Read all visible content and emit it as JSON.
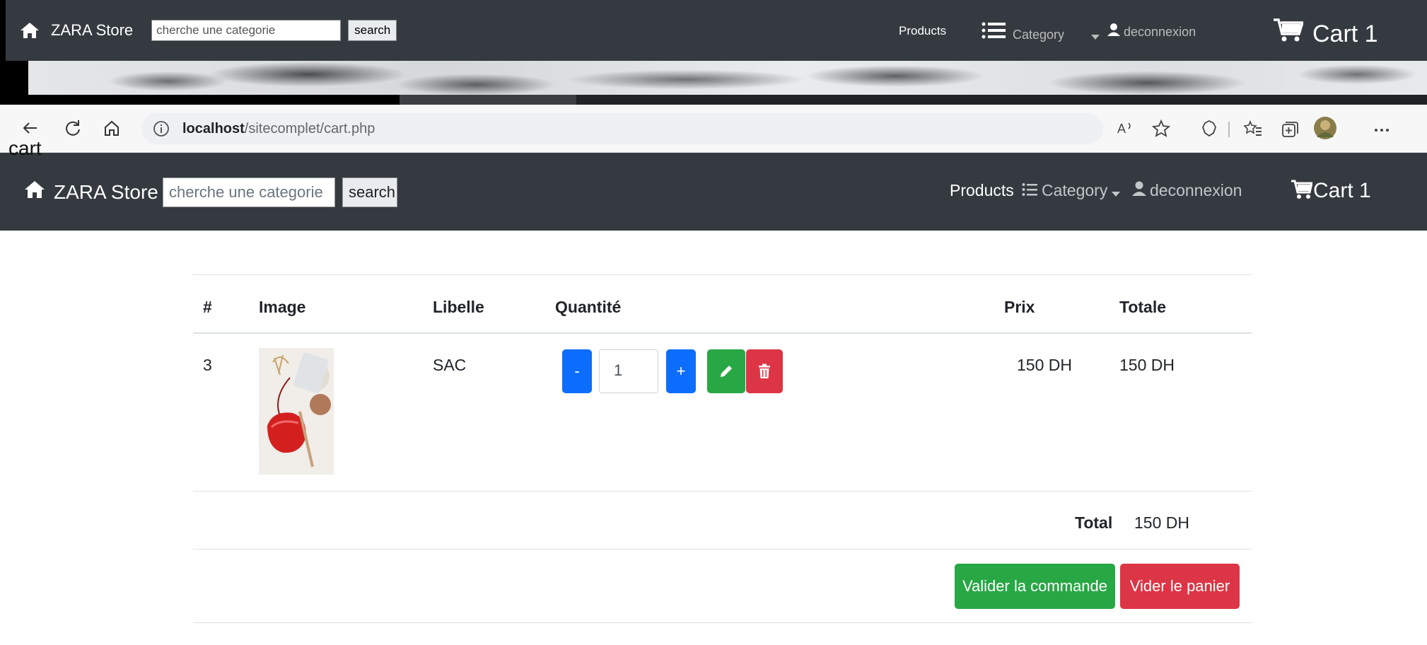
{
  "outer_nav": {
    "brand": "ZARA Store",
    "search_placeholder": "cherche une categorie",
    "search_label": "search",
    "products": "Products",
    "category": "Category",
    "logout": "deconnexion",
    "cart": "Cart 1"
  },
  "browser": {
    "url_host": "localhost",
    "url_path": "/sitecomplet/cart.php",
    "read_aloud": "A"
  },
  "inner_nav": {
    "brand": "ZARA Store",
    "search_placeholder": "cherche une categorie",
    "search_label": "search",
    "products": "Products",
    "category": "Category",
    "logout": "deconnexion",
    "cart": "Cart 1"
  },
  "page": {
    "title": "cart",
    "columns": [
      "#",
      "Image",
      "Libelle",
      "Quantité",
      "Prix",
      "Totale"
    ],
    "rows": [
      {
        "id": "3",
        "libelle": "SAC",
        "quantity": "1",
        "price": "150 DH",
        "total": "150 DH"
      }
    ],
    "minus_label": "-",
    "plus_label": "+",
    "grand_total_label": "Total",
    "grand_total_value": "150 DH",
    "validate_button": "Valider la commande",
    "empty_button": "Vider le panier"
  },
  "colors": {
    "navbar": "#343a40",
    "primary": "#0d6efd",
    "success": "#28a745",
    "danger": "#dc3545"
  }
}
